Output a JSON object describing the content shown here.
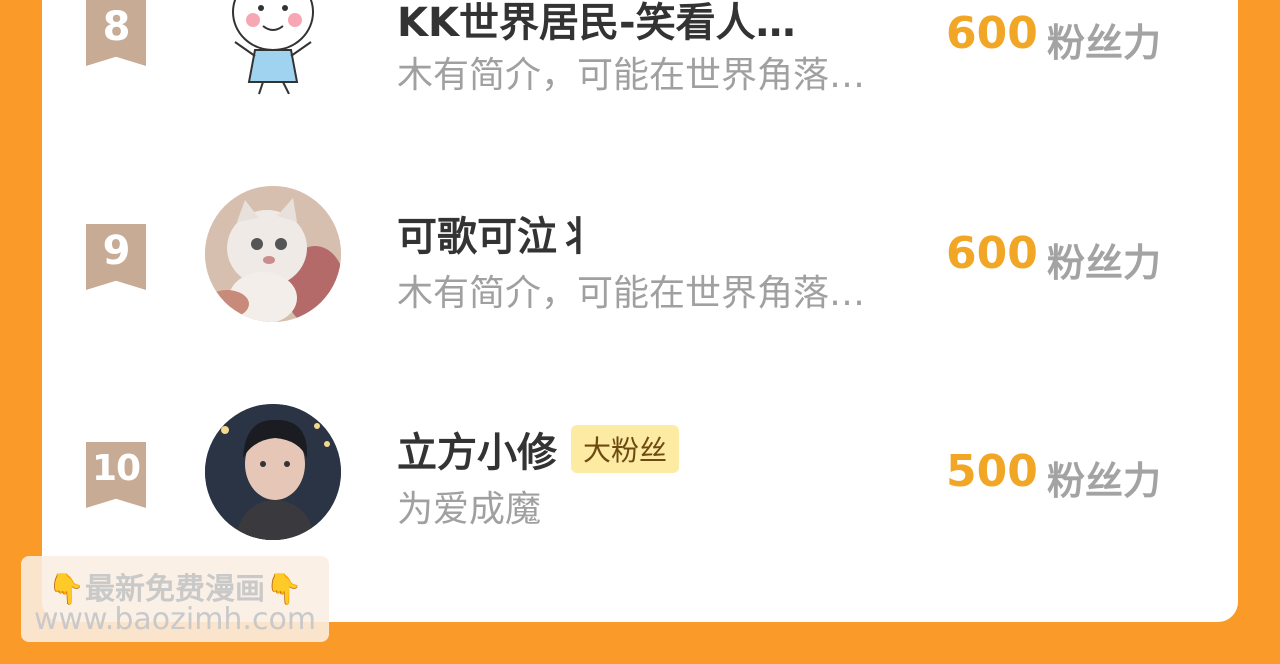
{
  "list": [
    {
      "rank": "8",
      "name": "KK世界居民-笑看人…",
      "badge": "",
      "desc": "木有简介，可能在世界角落…",
      "score": "600",
      "unit": "粉丝力",
      "avatar_icon": "cartoon-kid-avatar"
    },
    {
      "rank": "9",
      "name": "可歌可泣丬",
      "badge": "",
      "desc": "木有简介，可能在世界角落…",
      "score": "600",
      "unit": "粉丝力",
      "avatar_icon": "cat-photo-avatar"
    },
    {
      "rank": "10",
      "name": "立方小修",
      "badge": "大粉丝",
      "desc": "为爱成魔",
      "score": "500",
      "unit": "粉丝力",
      "avatar_icon": "person-photo-avatar"
    }
  ],
  "watermark": {
    "line1": "最新免费漫画",
    "line2": "www.baozimh.com",
    "icon": "pointing-down-hand-icon"
  },
  "colors": {
    "background": "#fa9a28",
    "score": "#f1a626",
    "rank_ribbon": "#c8ab95",
    "badge_bg": "#fdeba3"
  }
}
